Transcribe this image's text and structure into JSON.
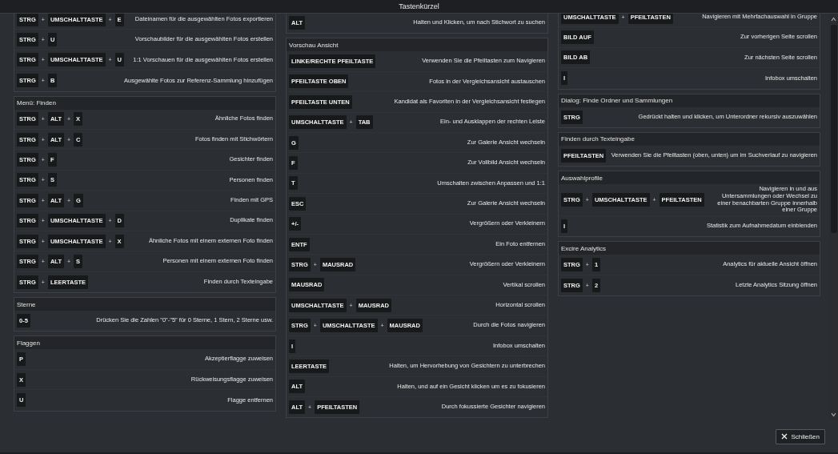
{
  "window": {
    "title": "Tastenkürzel"
  },
  "columns": [
    {
      "sections": [
        {
          "rows": [
            {
              "keys": [
                "STRG",
                "UMSCHALTTASTE",
                "E"
              ],
              "joiners": [
                "+",
                "+"
              ],
              "action": "Dateinamen für die ausgewählten Fotos exportieren"
            },
            {
              "keys": [
                "STRG",
                "U"
              ],
              "joiners": [
                "+"
              ],
              "action": "Vorschaubilder für die ausgewählten Fotos erstellen"
            },
            {
              "keys": [
                "STRG",
                "UMSCHALTTASTE",
                "U"
              ],
              "joiners": [
                "+",
                "+"
              ],
              "action": "1:1 Vorschauen für die ausgewählten Fotos erstellen"
            },
            {
              "keys": [
                "STRG",
                "B"
              ],
              "joiners": [
                "+"
              ],
              "action": "Ausgewählte Fotos zur Referenz-Sammlung hinzufügen"
            }
          ]
        },
        {
          "title": "Menü: Finden",
          "rows": [
            {
              "keys": [
                "STRG",
                "ALT",
                "X"
              ],
              "joiners": [
                "+",
                "+"
              ],
              "action": "Ähnliche Fotos finden"
            },
            {
              "keys": [
                "STRG",
                "ALT",
                "C"
              ],
              "joiners": [
                "+",
                "+"
              ],
              "action": "Fotos finden mit Stichwörtern"
            },
            {
              "keys": [
                "STRG",
                "F"
              ],
              "joiners": [
                "+"
              ],
              "action": "Gesichter finden"
            },
            {
              "keys": [
                "STRG",
                "S"
              ],
              "joiners": [
                "+"
              ],
              "action": "Personen finden"
            },
            {
              "keys": [
                "STRG",
                "ALT",
                "G"
              ],
              "joiners": [
                "+",
                "+"
              ],
              "action": "Finden mit GPS"
            },
            {
              "keys": [
                "STRG",
                "UMSCHALTTASTE",
                "D"
              ],
              "joiners": [
                "+",
                "+"
              ],
              "action": "Duplikate finden"
            },
            {
              "keys": [
                "STRG",
                "UMSCHALTTASTE",
                "X"
              ],
              "joiners": [
                "+",
                "+"
              ],
              "action": "Ähnliche Fotos mit einem externen Foto finden"
            },
            {
              "keys": [
                "STRG",
                "ALT",
                "S"
              ],
              "joiners": [
                "+",
                "+"
              ],
              "action": "Personen mit einem externen Foto finden"
            },
            {
              "keys": [
                "STRG",
                "LEERTASTE"
              ],
              "joiners": [
                "+"
              ],
              "action": "Finden durch Texteingabe"
            }
          ]
        },
        {
          "title": "Sterne",
          "rows": [
            {
              "keys": [
                "0-5"
              ],
              "action": "Drücken Sie die Zahlen \"0\"-\"5\" für 0 Sterne, 1 Stern, 2 Sterne usw."
            }
          ]
        },
        {
          "title": "Flaggen",
          "rows": [
            {
              "keys": [
                "P"
              ],
              "action": "Akzeptierflagge zuweisen"
            },
            {
              "keys": [
                "X"
              ],
              "action": "Rückweisungsflagge zuweisen"
            },
            {
              "keys": [
                "U"
              ],
              "action": "Flagge entfernen"
            }
          ]
        }
      ]
    },
    {
      "sections": [
        {
          "rows": [
            {
              "keys": [
                "ALT"
              ],
              "action": "Halten und Klicken, um nach Stichwort zu suchen"
            }
          ]
        },
        {
          "title": "Vorschau Ansicht",
          "rows": [
            {
              "keys": [
                "LINKE/RECHTE PFEILTASTE"
              ],
              "action": "Verwenden Sie die Pfeiltasten zum Navigieren"
            },
            {
              "keys": [
                "PFEILTASTE OBEN"
              ],
              "action": "Fotos in der Vergleichsansicht austauschen"
            },
            {
              "keys": [
                "PFEILTASTE UNTEN"
              ],
              "action": "Kandidat als Favoriten in der Vergleichsansicht festlegen"
            },
            {
              "keys": [
                "UMSCHALTTASTE",
                "TAB"
              ],
              "joiners": [
                "+"
              ],
              "action": "Ein- und Ausklappen der rechten Leiste"
            },
            {
              "keys": [
                "G"
              ],
              "action": "Zur Galerie Ansicht wechseln"
            },
            {
              "keys": [
                "F"
              ],
              "action": "Zur Vollbild Ansicht wechseln"
            },
            {
              "keys": [
                "T"
              ],
              "action": "Umschalten zwischen Anpassen und 1:1"
            },
            {
              "keys": [
                "ESC"
              ],
              "action": "Zur Galerie Ansicht wechseln"
            },
            {
              "keys": [
                "+/-"
              ],
              "action": "Vergrößern oder Verkleinern"
            },
            {
              "keys": [
                "ENTF"
              ],
              "action": "Ein Foto entfernen"
            },
            {
              "keys": [
                "STRG",
                "MAUSRAD"
              ],
              "joiners": [
                "+"
              ],
              "action": "Vergrößern oder Verkleinern"
            },
            {
              "keys": [
                "MAUSRAD"
              ],
              "action": "Vertikal scrollen"
            },
            {
              "keys": [
                "UMSCHALTTASTE",
                "MAUSRAD"
              ],
              "joiners": [
                "+"
              ],
              "action": "Horizontal scrollen"
            },
            {
              "keys": [
                "STRG",
                "UMSCHALTTASTE",
                "MAUSRAD"
              ],
              "joiners": [
                "+",
                "+"
              ],
              "action": "Durch die Fotos navigieren"
            },
            {
              "keys": [
                "I"
              ],
              "action": "Infobox umschalten"
            },
            {
              "keys": [
                "LEERTASTE"
              ],
              "action": "Halten, um Hervorhebung von Gesichtern zu unterbrechen"
            },
            {
              "keys": [
                "ALT"
              ],
              "action": "Halten, und auf ein Gesicht klicken um es zu fokusieren"
            },
            {
              "keys": [
                "ALT",
                "PFEILTASTEN"
              ],
              "joiners": [
                "+"
              ],
              "action": "Durch fokussierte Gesichter navigieren"
            }
          ]
        }
      ]
    },
    {
      "sections": [
        {
          "rows": [
            {
              "keys": [
                "UMSCHALTTASTE",
                "PFEILTASTEN"
              ],
              "joiners": [
                "+"
              ],
              "action": "Navigieren mit Mehrfachauswahl in Gruppe"
            },
            {
              "keys": [
                "BILD AUF"
              ],
              "action": "Zur vorherigen Seite scrollen"
            },
            {
              "keys": [
                "BILD AB"
              ],
              "action": "Zur nächsten Seite scrollen"
            },
            {
              "keys": [
                "I"
              ],
              "action": "Infobox umschalten"
            }
          ]
        },
        {
          "title": "Dialog: Finde Ordner und Sammlungen",
          "rows": [
            {
              "keys": [
                "STRG"
              ],
              "action": "Gedrückt halten und klicken, um Unterordner rekursiv auszuwählen"
            }
          ]
        },
        {
          "title": "Finden durch Texteingabe",
          "rows": [
            {
              "keys": [
                "PFEILTASTEN"
              ],
              "action": "Verwenden Sie die Pfeiltasten (oben, unten) um im Suchverlauf zu navigieren"
            }
          ]
        },
        {
          "title": "Auswahlprofile",
          "rows": [
            {
              "keys": [
                "STRG",
                "UMSCHALTTASTE",
                "PFEILTASTEN"
              ],
              "joiners": [
                "+",
                "+"
              ],
              "action": "Navigieren in und aus Untersammlungen oder Wechsel zu einer benachbarten Gruppe innerhalb einer Gruppe"
            },
            {
              "keys": [
                "I"
              ],
              "action": "Statistik zum Aufnahmedatum einblenden"
            }
          ]
        },
        {
          "title": "Excire Analytics",
          "rows": [
            {
              "keys": [
                "STRG",
                "1"
              ],
              "joiners": [
                "+"
              ],
              "action": "Analytics für aktuelle Ansicht öffnen"
            },
            {
              "keys": [
                "STRG",
                "2"
              ],
              "joiners": [
                "+"
              ],
              "action": "Letzte Analytics Sitzung öffnen"
            }
          ]
        }
      ]
    }
  ],
  "close_button": {
    "label": "Schließen"
  }
}
